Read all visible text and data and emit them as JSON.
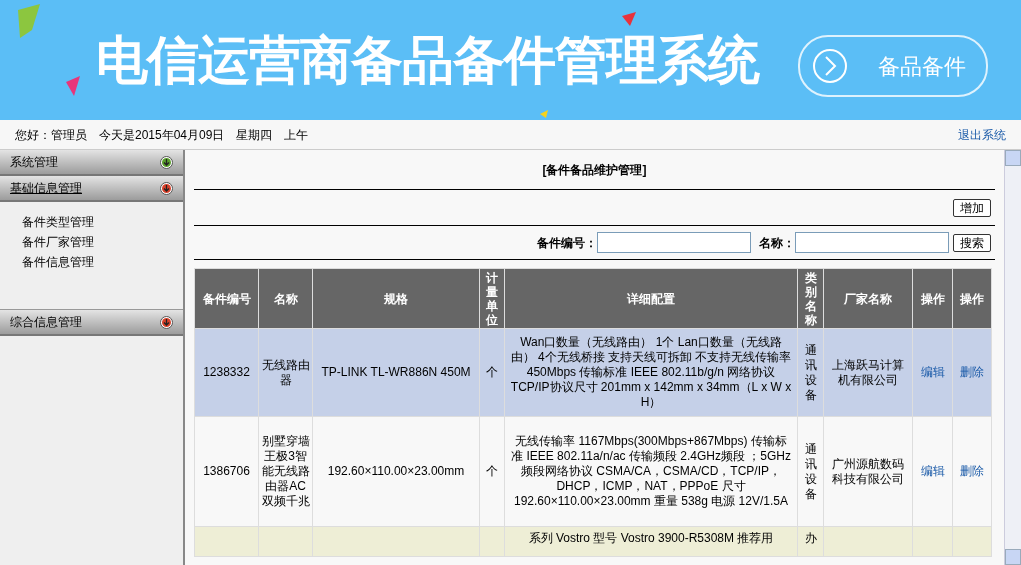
{
  "banner": {
    "title": "电信运营商备品备件管理系统",
    "button": "备品备件"
  },
  "top_bar": {
    "greeting": "您好：管理员",
    "date": "今天是2015年04月09日",
    "weekday": "星期四",
    "period": "上午",
    "logout": "退出系统"
  },
  "sidebar": {
    "groups": [
      {
        "label": "系统管理",
        "expanded": false,
        "color": "#5aa02c"
      },
      {
        "label": "基础信息管理",
        "expanded": true,
        "color": "#d8402a",
        "children": [
          {
            "label": "备件类型管理"
          },
          {
            "label": "备件厂家管理"
          },
          {
            "label": "备件信息管理"
          }
        ]
      },
      {
        "label": "综合信息管理",
        "expanded": false,
        "color": "#d8402a"
      }
    ]
  },
  "main": {
    "title": "[备件备品维护管理]",
    "add_button": "增加",
    "search": {
      "code_label": "备件编号：",
      "name_label": "名称：",
      "button": "搜索"
    },
    "table": {
      "columns": [
        "备件编号",
        "名称",
        "规格",
        "计量单位",
        "详细配置",
        "类别名称",
        "厂家名称",
        "操作",
        "操作"
      ],
      "rows": [
        {
          "selected": true,
          "cells": [
            "1238332",
            "无线路由器",
            "TP-LINK TL-WR886N 450M",
            "个",
            "Wan口数量（无线路由） 1个 Lan口数量（无线路由） 4个无线桥接 支持天线可拆卸 不支持无线传输率 450Mbps 传输标准 IEEE 802.11b/g/n 网络协议 TCP/IP协议尺寸 201mm x 142mm x 34mm（L x W x H）",
            "通讯设备",
            "上海跃马计算机有限公司",
            "编辑",
            "删除"
          ]
        },
        {
          "selected": false,
          "cells": [
            "1386706",
            "别墅穿墙王极3智能无线路由器AC双频千兆",
            "192.60×110.00×23.00mm",
            "个",
            "无线传输率 1167Mbps(300Mbps+867Mbps) 传输标准 IEEE 802.11a/n/ac 传输频段 2.4GHz频段 ；5GHz频段网络协议 CSMA/CA，CSMA/CD，TCP/IP，DHCP，ICMP，NAT，PPPoE 尺寸 192.60×110.00×23.00mm 重量 538g 电源 12V/1.5A",
            "通讯设备",
            "广州源航数码科技有限公司",
            "编辑",
            "删除"
          ]
        },
        {
          "selected": false,
          "cells": [
            "",
            "",
            "",
            "",
            "系列 Vostro 型号 Vostro 3900-R5308M 推荐用",
            "办",
            "",
            "",
            ""
          ]
        }
      ]
    }
  }
}
